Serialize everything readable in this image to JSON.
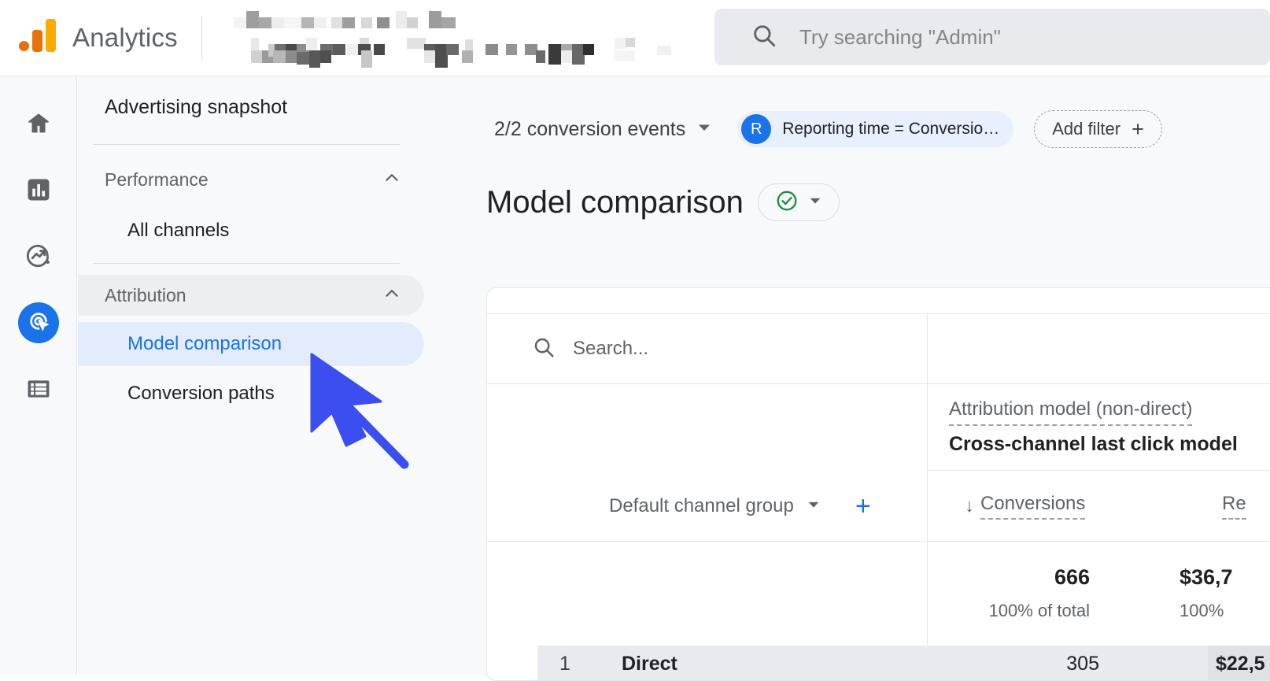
{
  "header": {
    "brand": "Analytics",
    "logo_colors": {
      "orange": "#e8710a",
      "yellow": "#f9ab00"
    },
    "property_redacted": true,
    "search": {
      "placeholder": "Try searching \"Admin\"",
      "icon": "search-icon",
      "value": ""
    }
  },
  "rail": {
    "items": [
      {
        "name": "home",
        "icon": "home-icon",
        "active": false
      },
      {
        "name": "reports",
        "icon": "bar-chart-icon",
        "active": false
      },
      {
        "name": "explore",
        "icon": "explore-trend-icon",
        "active": false
      },
      {
        "name": "advertising",
        "icon": "advertising-target-cursor-icon",
        "active": true
      },
      {
        "name": "library",
        "icon": "list-icon",
        "active": false
      }
    ],
    "active_color": "#1a73e8",
    "icon_color": "#5f6368"
  },
  "sidebar": {
    "snapshot_label": "Advertising snapshot",
    "groups": [
      {
        "label": "Performance",
        "expanded": true,
        "chevron": "chevron-up-icon",
        "hovered": false,
        "items": [
          {
            "label": "All channels",
            "selected": false
          }
        ]
      },
      {
        "label": "Attribution",
        "expanded": true,
        "chevron": "chevron-up-icon",
        "hovered": true,
        "items": [
          {
            "label": "Model comparison",
            "selected": true
          },
          {
            "label": "Conversion paths",
            "selected": false
          }
        ]
      }
    ],
    "selected_color": "#1a73e8",
    "selected_bg": "#e3ecfd"
  },
  "toolbar": {
    "conversion_events": "2/2 conversion events",
    "conversion_events_caret": "caret-down-icon",
    "filter_chip": {
      "avatar_letter": "R",
      "text": "Reporting time = Conversio…",
      "bg": "#e8f0fe",
      "avatar_bg": "#1a73e8"
    },
    "add_filter": {
      "label": "Add filter",
      "icon": "plus-icon"
    }
  },
  "page": {
    "title": "Model comparison",
    "title_badge_icon": "check-circle-icon",
    "title_badge_caret": "caret-down-icon",
    "badge_color": "#1e8e3e"
  },
  "table": {
    "search": {
      "placeholder": "Search...",
      "icon": "search-icon",
      "value": ""
    },
    "model_column": {
      "label": "Attribution model (non-direct)",
      "value": "Cross-channel last click model"
    },
    "dimension_header": {
      "label": "Default channel group",
      "caret": "caret-down-icon",
      "add_icon": "plus-icon"
    },
    "metric_headers": [
      {
        "label": "Conversions",
        "sorted": true,
        "sort_icon": "arrow-down-icon"
      },
      {
        "label": "Re",
        "sorted": false,
        "truncated": true
      }
    ],
    "totals": [
      {
        "value": "666",
        "sub": "100% of total"
      },
      {
        "value": "$36,7",
        "sub": "100% ",
        "truncated": true
      }
    ],
    "rows": [
      {
        "rank": "1",
        "dimension": "Direct",
        "conversions": "305",
        "revenue": "$22,5"
      }
    ]
  },
  "cursor": {
    "color": "#3b4ef0",
    "type": "arrow-pointer"
  }
}
